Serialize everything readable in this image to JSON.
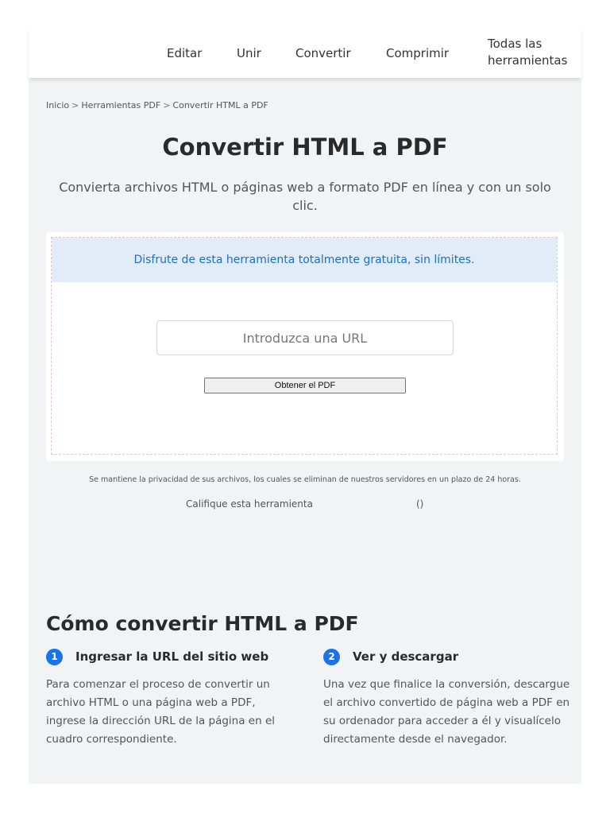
{
  "nav": {
    "items": [
      {
        "label": "Editar"
      },
      {
        "label": "Unir"
      },
      {
        "label": "Convertir"
      },
      {
        "label": "Comprimir"
      },
      {
        "label_line1": "Todas las",
        "label_line2": "herramientas"
      }
    ]
  },
  "breadcrumb": {
    "items": [
      "Inicio",
      "Herramientas PDF",
      "Convertir HTML a PDF"
    ],
    "separator": ">"
  },
  "page": {
    "title": "Convertir HTML a PDF",
    "subtitle": "Convierta archivos HTML o páginas web a formato PDF en línea y con un solo clic."
  },
  "tool": {
    "promo": "Disfrute de esta herramienta totalmente gratuita, sin límites.",
    "url_placeholder": "Introduzca una URL",
    "url_value": "",
    "button_label": "Obtener el PDF"
  },
  "privacy_note": "Se mantiene la privacidad de sus archivos, los cuales se eliminan de nuestros servidores en un plazo de 24 horas.",
  "rating": {
    "label": "Califique esta herramienta",
    "value": "()"
  },
  "howto": {
    "title": "Cómo convertir HTML a PDF",
    "steps": [
      {
        "number": "1",
        "title": "Ingresar la URL del sitio web",
        "text": "Para comenzar el proceso de convertir un archivo HTML o una página web a PDF, ingrese la dirección URL de la página en el cuadro correspondiente."
      },
      {
        "number": "2",
        "title": "Ver y descargar",
        "text": "Una vez que finalice la conversión, descargue el archivo convertido de página web a PDF en su ordenador para acceder a él y visualícelo directamente desde el navegador."
      }
    ]
  },
  "colors": {
    "accent": "#1a73e8",
    "promo_background": "#e1ecf8",
    "panel_background": "#f2f3f5"
  }
}
